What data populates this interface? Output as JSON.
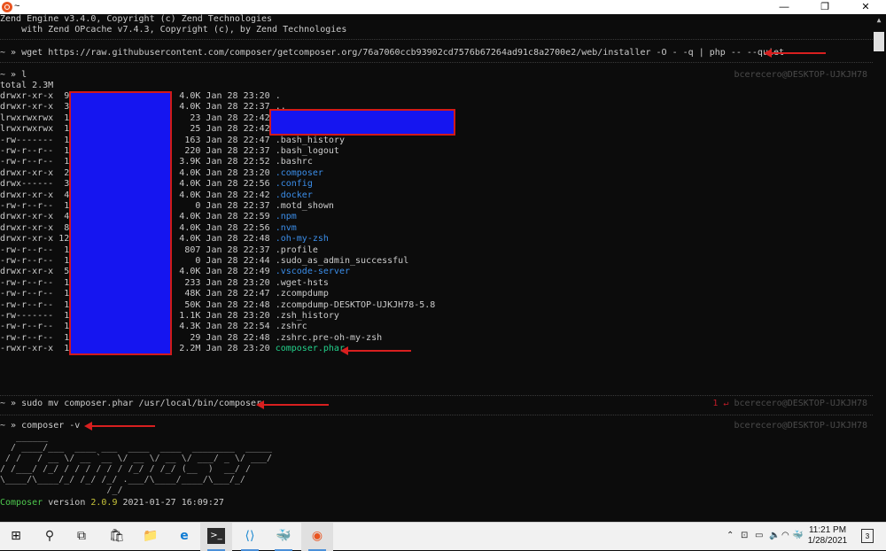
{
  "window": {
    "title": "~",
    "minimize": "—",
    "maximize": "❐",
    "close": "✕",
    "accent": "#e95420"
  },
  "terminal": {
    "header_lines": [
      "Zend Engine v3.4.0, Copyright (c) Zend Technologies",
      "    with Zend OPcache v7.4.3, Copyright (c), by Zend Technologies"
    ],
    "prompt_symbol": "~ »",
    "cmd_wget": "wget https://raw.githubusercontent.com/composer/getcomposer.org/76a7060ccb93902cd7576b67264ad91c8a2700e2/web/installer -O - -q | php -- --quiet",
    "cmd_ls": "l",
    "rprompt_user": "bcerecero@DESKTOP-UJKJH78",
    "total": "total 2.3M",
    "listing": [
      {
        "perm": "drwxr-xr-x",
        "links": " 9",
        "size": "4.0K",
        "date": "Jan 28 23:20",
        "name": ".",
        "type": "plain"
      },
      {
        "perm": "drwxr-xr-x",
        "links": " 3",
        "size": "4.0K",
        "date": "Jan 28 22:37",
        "name": "..",
        "type": "plain"
      },
      {
        "perm": "lrwxrwxrwx",
        "links": " 1",
        "size": "  23",
        "date": "Jan 28 22:42",
        "name": "",
        "type": "plain"
      },
      {
        "perm": "lrwxrwxrwx",
        "links": " 1",
        "size": "  25",
        "date": "Jan 28 22:42",
        "name": "",
        "type": "plain"
      },
      {
        "perm": "-rw-------",
        "links": " 1",
        "size": " 163",
        "date": "Jan 28 22:47",
        "name": ".bash_history",
        "type": "plain"
      },
      {
        "perm": "-rw-r--r--",
        "links": " 1",
        "size": " 220",
        "date": "Jan 28 22:37",
        "name": ".bash_logout",
        "type": "plain"
      },
      {
        "perm": "-rw-r--r--",
        "links": " 1",
        "size": "3.9K",
        "date": "Jan 28 22:52",
        "name": ".bashrc",
        "type": "plain"
      },
      {
        "perm": "drwxr-xr-x",
        "links": " 2",
        "size": "4.0K",
        "date": "Jan 28 23:20",
        "name": ".composer",
        "type": "dir"
      },
      {
        "perm": "drwx------",
        "links": " 3",
        "size": "4.0K",
        "date": "Jan 28 22:56",
        "name": ".config",
        "type": "dir"
      },
      {
        "perm": "drwxr-xr-x",
        "links": " 4",
        "size": "4.0K",
        "date": "Jan 28 22:42",
        "name": ".docker",
        "type": "dir"
      },
      {
        "perm": "-rw-r--r--",
        "links": " 1",
        "size": "   0",
        "date": "Jan 28 22:37",
        "name": ".motd_shown",
        "type": "plain"
      },
      {
        "perm": "drwxr-xr-x",
        "links": " 4",
        "size": "4.0K",
        "date": "Jan 28 22:59",
        "name": ".npm",
        "type": "dir"
      },
      {
        "perm": "drwxr-xr-x",
        "links": " 8",
        "size": "4.0K",
        "date": "Jan 28 22:56",
        "name": ".nvm",
        "type": "dir"
      },
      {
        "perm": "drwxr-xr-x",
        "links": "12",
        "size": "4.0K",
        "date": "Jan 28 22:48",
        "name": ".oh-my-zsh",
        "type": "dir"
      },
      {
        "perm": "-rw-r--r--",
        "links": " 1",
        "size": " 807",
        "date": "Jan 28 22:37",
        "name": ".profile",
        "type": "plain"
      },
      {
        "perm": "-rw-r--r--",
        "links": " 1",
        "size": "   0",
        "date": "Jan 28 22:44",
        "name": ".sudo_as_admin_successful",
        "type": "plain"
      },
      {
        "perm": "drwxr-xr-x",
        "links": " 5",
        "size": "4.0K",
        "date": "Jan 28 22:49",
        "name": ".vscode-server",
        "type": "dir"
      },
      {
        "perm": "-rw-r--r--",
        "links": " 1",
        "size": " 233",
        "date": "Jan 28 23:20",
        "name": ".wget-hsts",
        "type": "plain"
      },
      {
        "perm": "-rw-r--r--",
        "links": " 1",
        "size": " 48K",
        "date": "Jan 28 22:47",
        "name": ".zcompdump",
        "type": "plain"
      },
      {
        "perm": "-rw-r--r--",
        "links": " 1",
        "size": " 50K",
        "date": "Jan 28 22:48",
        "name": ".zcompdump-DESKTOP-UJKJH78-5.8",
        "type": "plain"
      },
      {
        "perm": "-rw-------",
        "links": " 1",
        "size": "1.1K",
        "date": "Jan 28 23:20",
        "name": ".zsh_history",
        "type": "plain"
      },
      {
        "perm": "-rw-r--r--",
        "links": " 1",
        "size": "4.3K",
        "date": "Jan 28 22:54",
        "name": ".zshrc",
        "type": "plain"
      },
      {
        "perm": "-rw-r--r--",
        "links": " 1",
        "size": "  29",
        "date": "Jan 28 22:48",
        "name": ".zshrc.pre-oh-my-zsh",
        "type": "plain"
      },
      {
        "perm": "-rwxr-xr-x",
        "links": " 1",
        "size": "2.2M",
        "date": "Jan 28 23:20",
        "name": "composer.phar",
        "type": "exec"
      }
    ],
    "cmd_mv": "sudo mv composer.phar /usr/local/bin/composer",
    "mv_status": "1 ↵",
    "cmd_version": "composer -v",
    "ascii_logo": [
      "   ______",
      "  / ____/___  ____ ___  ____  ____  ________  _____",
      " / /   / __ \\/ __ `__ \\/ __ \\/ __ \\/ ___/ _ \\/ ___/",
      "/ /___/ /_/ / / / / / / /_/ / /_/ (__  )  __/ /",
      "\\____/\\____/_/ /_/ /_/ .___/\\____/____/\\___/_/",
      "                    /_/"
    ],
    "version_word": "Composer",
    "version_label": " version ",
    "version_number": "2.0.9",
    "version_date": " 2021-01-27 16:09:27"
  },
  "taskbar": {
    "items": [
      {
        "icon": "windows-start-icon",
        "glyph": "⊞"
      },
      {
        "icon": "search-icon",
        "glyph": "⚲"
      },
      {
        "icon": "task-view-icon",
        "glyph": "⧉"
      },
      {
        "icon": "store-icon",
        "glyph": "🛍"
      },
      {
        "icon": "file-explorer-icon",
        "glyph": "📁"
      },
      {
        "icon": "edge-icon",
        "glyph": "e"
      },
      {
        "icon": "terminal-icon",
        "glyph": ">_"
      },
      {
        "icon": "vscode-icon",
        "glyph": "⟨⟩"
      },
      {
        "icon": "docker-icon",
        "glyph": "🐳"
      },
      {
        "icon": "ubuntu-icon",
        "glyph": "◉"
      }
    ],
    "time": "11:21 PM",
    "date": "1/28/2021",
    "notifications": "3",
    "colors": {
      "ubuntu": "#e95420",
      "vscode": "#1f8ad2",
      "edge": "#0f7bd4",
      "docker": "#2496ed"
    }
  }
}
